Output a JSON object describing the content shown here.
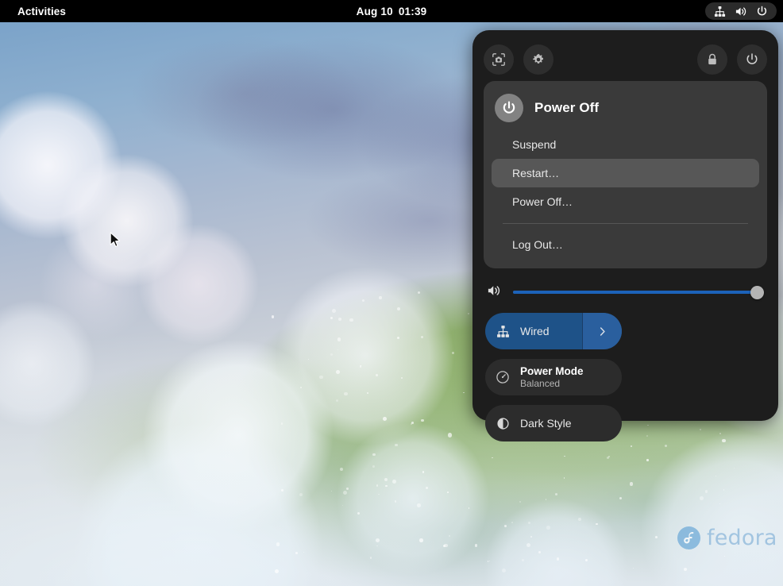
{
  "topbar": {
    "activities": "Activities",
    "clock_date": "Aug 10",
    "clock_time": "01:39",
    "status_icons": [
      {
        "name": "wired-network-icon",
        "label": "Wired Network"
      },
      {
        "name": "volume-icon",
        "label": "Volume"
      },
      {
        "name": "power-icon",
        "label": "Power"
      }
    ]
  },
  "quick_settings": {
    "header_buttons": [
      {
        "name": "screenshot-button",
        "label": "Take Screenshot"
      },
      {
        "name": "settings-button",
        "label": "Settings"
      },
      {
        "name": "lock-button",
        "label": "Lock Screen"
      },
      {
        "name": "power-button",
        "label": "Power Off / Log Out"
      }
    ],
    "submenu": {
      "title": "Power Off",
      "items": [
        {
          "label": "Suspend",
          "selected": false
        },
        {
          "label": "Restart…",
          "selected": true
        },
        {
          "label": "Power Off…",
          "selected": false
        }
      ],
      "items_after_separator": [
        {
          "label": "Log Out…",
          "selected": false
        }
      ]
    },
    "volume": {
      "icon": "volume-high-icon",
      "value": 100,
      "min": 0,
      "max": 100
    },
    "tiles": [
      {
        "name": "wired-toggle",
        "icon": "wired-network-icon",
        "label": "Wired",
        "sublabel": "",
        "active": true,
        "has_expand": true,
        "expand_icon": "chevron-right-icon"
      },
      {
        "name": "power-mode-toggle",
        "icon": "speedometer-icon",
        "label": "Power Mode",
        "sublabel": "Balanced",
        "active": false,
        "has_expand": false,
        "expand_icon": ""
      },
      {
        "name": "dark-style-toggle",
        "icon": "dark-style-icon",
        "label": "Dark Style",
        "sublabel": "",
        "active": false,
        "has_expand": false,
        "expand_icon": ""
      }
    ]
  },
  "desktop": {
    "watermark_text": "fedora",
    "watermark_logo": "fedora-logo-icon"
  },
  "colors": {
    "accent_blue": "#1c62b9",
    "tile_active": "#1e5288",
    "panel_bg": "#1d1d1d",
    "submenu_bg": "#3a3a3a",
    "selected_item": "#575757",
    "topbar_bg": "#000000",
    "fedora_blue": "#7aacd6"
  }
}
